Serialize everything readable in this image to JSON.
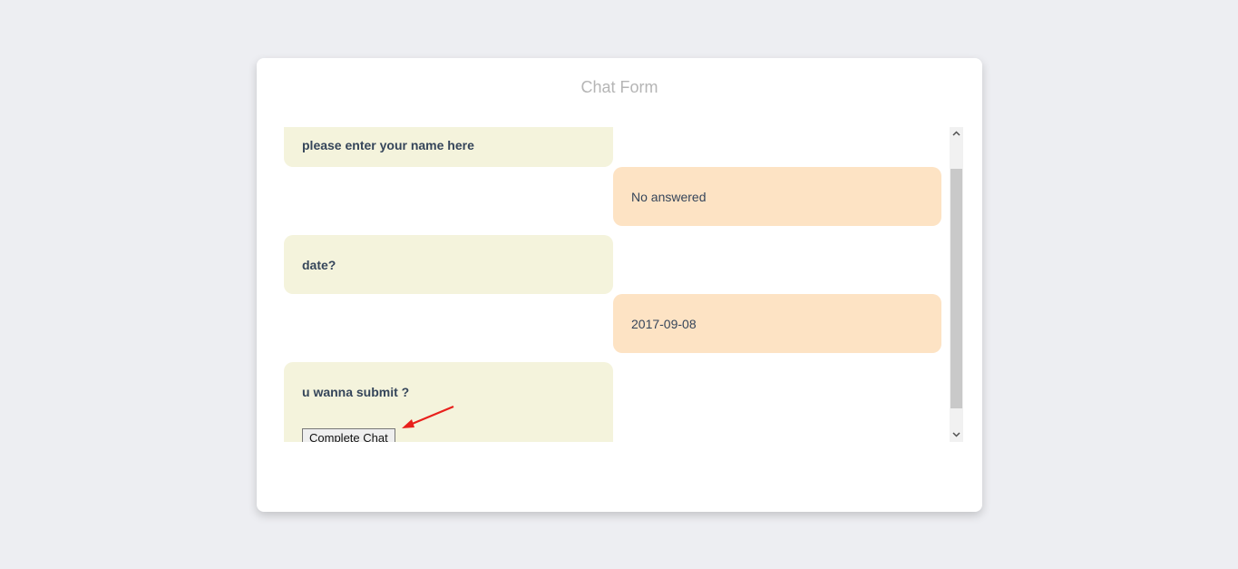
{
  "form": {
    "title": "Chat Form"
  },
  "messages": [
    {
      "from": "bot",
      "text": "please enter your name here"
    },
    {
      "from": "user",
      "text": "No answered"
    },
    {
      "from": "bot",
      "text": "date?"
    },
    {
      "from": "user",
      "text": "2017-09-08"
    },
    {
      "from": "bot",
      "text": "u wanna submit ?"
    }
  ],
  "actions": {
    "complete_label": "Complete Chat"
  },
  "colors": {
    "page_background": "#edeef2",
    "bot_bubble": "#f4f3dc",
    "user_bubble": "#fde3c4",
    "annotation_arrow": "#e8201c"
  }
}
